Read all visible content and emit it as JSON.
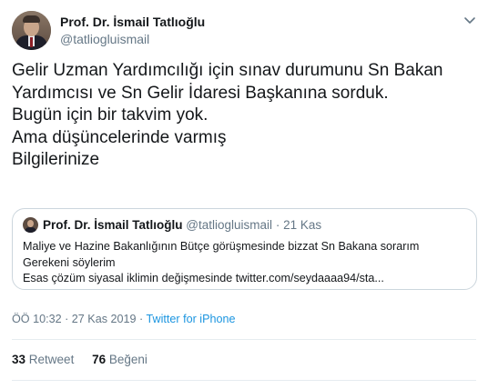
{
  "author": {
    "name": "Prof. Dr. İsmail Tatlıoğlu",
    "handle": "@tatliogluismail"
  },
  "tweet": {
    "lines": [
      "Gelir Uzman Yardımcılığı için sınav durumunu Sn Bakan",
      "Yardımcısı ve Sn Gelir İdaresi Başkanına sorduk.",
      "Bugün için bir takvim yok.",
      "Ama düşüncelerinde varmış",
      "Bilgilerinize"
    ],
    "timestamp": "ÖÖ 10:32 · 27 Kas 2019",
    "separator": "·",
    "source": "Twitter for iPhone"
  },
  "quoted": {
    "name": "Prof. Dr. İsmail Tatlıoğlu",
    "handle": "@tatliogluismail",
    "dot": "·",
    "date": "21 Kas",
    "lines": [
      "Maliye ve Hazine Bakanlığının Bütçe görüşmesinde bizzat Sn Bakana sorarım",
      "Gerekeni söylerim",
      "Esas çözüm siyasal iklimin değişmesinde twitter.com/seydaaaa94/sta..."
    ]
  },
  "stats": {
    "retweets": "33",
    "retweets_label": "Retweet",
    "likes": "76",
    "likes_label": "Beğeni"
  },
  "icons": {
    "menu": "chevron-down-icon"
  },
  "colors": {
    "text": "#14171a",
    "secondary": "#657786",
    "link": "#1b95e0",
    "border": "#ccd6dd"
  }
}
